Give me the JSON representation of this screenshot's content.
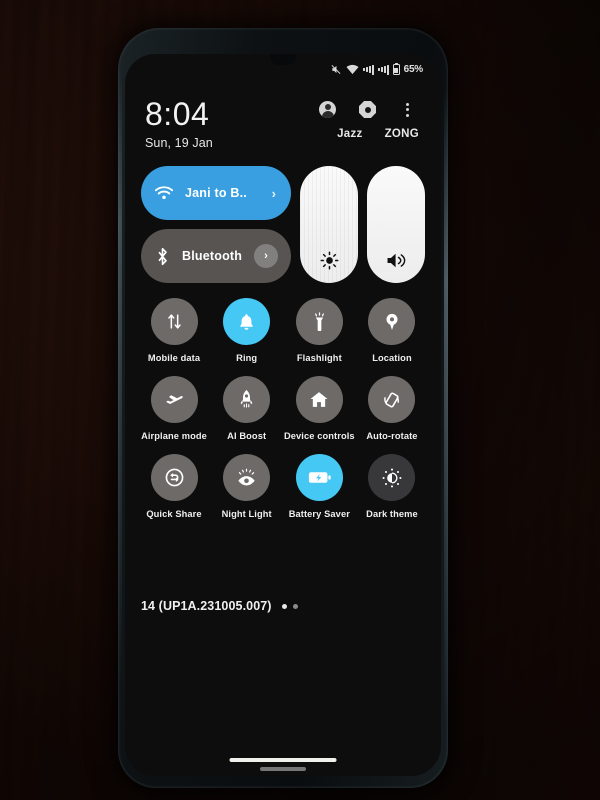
{
  "status_bar": {
    "icons": [
      "mute-icon",
      "wifi-icon",
      "signal-sim1-icon",
      "signal-sim2-icon",
      "battery-icon"
    ],
    "battery_percent": "65%"
  },
  "header": {
    "clock": "8:04",
    "date": "Sun, 19 Jan",
    "icons": [
      "user-avatar-icon",
      "settings-gear-icon",
      "overflow-menu-icon"
    ],
    "carriers": [
      "Jazz",
      "ZONG"
    ]
  },
  "connectivity": {
    "wifi": {
      "label": "Jani to B..",
      "icon": "wifi-icon",
      "state": "on",
      "chevron": "›"
    },
    "bluetooth": {
      "label": "Bluetooth",
      "icon": "bluetooth-icon",
      "state": "off",
      "chevron": "›"
    }
  },
  "sliders": [
    {
      "name": "brightness",
      "icon": "brightness-icon",
      "level": 100
    },
    {
      "name": "volume",
      "icon": "volume-icon",
      "level": 100
    }
  ],
  "tiles": [
    [
      {
        "label": "Mobile data",
        "icon": "mobile-data-icon",
        "state": "off"
      },
      {
        "label": "Ring",
        "icon": "bell-icon",
        "state": "active"
      },
      {
        "label": "Flashlight",
        "icon": "flashlight-icon",
        "state": "off"
      },
      {
        "label": "Location",
        "icon": "location-icon",
        "state": "off"
      }
    ],
    [
      {
        "label": "Airplane mode",
        "icon": "airplane-icon",
        "state": "off"
      },
      {
        "label": "AI Boost",
        "icon": "rocket-icon",
        "state": "off"
      },
      {
        "label": "Device controls",
        "icon": "home-icon",
        "state": "off"
      },
      {
        "label": "Auto-rotate",
        "icon": "auto-rotate-icon",
        "state": "off"
      }
    ],
    [
      {
        "label": "Quick Share",
        "icon": "quick-share-icon",
        "state": "off"
      },
      {
        "label": "Night Light",
        "icon": "night-light-icon",
        "state": "off"
      },
      {
        "label": "Battery Saver",
        "icon": "battery-saver-icon",
        "state": "active"
      },
      {
        "label": "Dark theme",
        "icon": "dark-theme-icon",
        "state": "dim"
      }
    ]
  ],
  "footer": {
    "build": "14 (UP1A.231005.007)",
    "pages": 2,
    "current_page": 1
  },
  "colors": {
    "accent_on": "#3a9fe0",
    "tile_active": "#46c8f5",
    "tile_off": "#6d6a68",
    "tile_dim": "#38373a",
    "screen_bg": "#0d0d0d"
  }
}
